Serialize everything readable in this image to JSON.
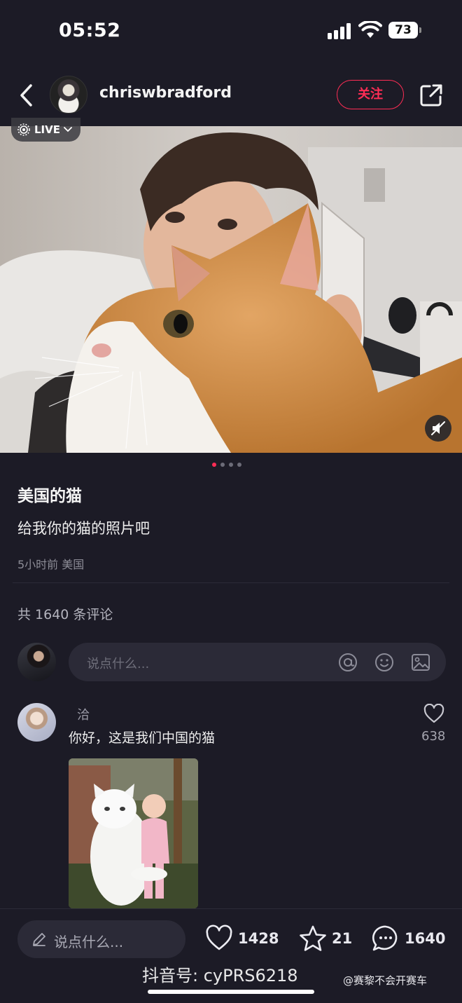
{
  "status_bar": {
    "time": "05:52",
    "battery": "73"
  },
  "header": {
    "username": "chriswbradford",
    "follow_label": "关注"
  },
  "photo": {
    "live_label": "LIVE"
  },
  "post": {
    "title": "美国的猫",
    "body": "给我你的猫的照片吧",
    "meta": "5小时前 美国",
    "comments_count_label": "共 1640 条评论"
  },
  "comment_input": {
    "placeholder": "说点什么..."
  },
  "comment": {
    "author": "洽",
    "text": "你好，这是我们中国的猫",
    "likes": "638"
  },
  "bottom_bar": {
    "input_placeholder": "说点什么...",
    "likes": "1428",
    "favorites": "21",
    "comments": "1640"
  },
  "watermark": {
    "main": "抖音号: cyPRS6218",
    "weibo": "@赛黎不会开赛车"
  },
  "colors": {
    "background": "#1c1b26",
    "accent": "#ff2d55",
    "input_bg": "#2b2a37"
  }
}
